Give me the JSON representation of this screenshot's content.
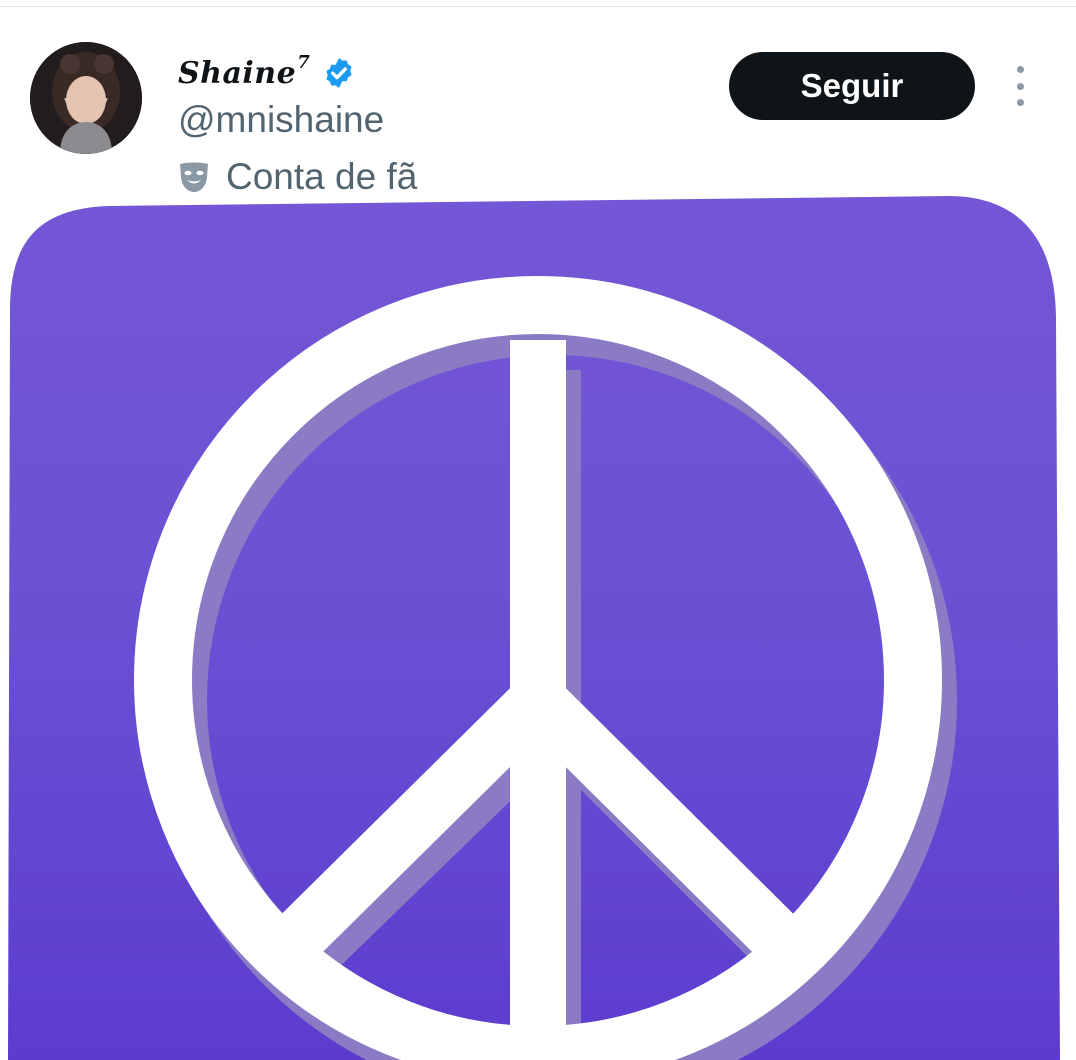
{
  "author": {
    "display_name": "Shaine",
    "display_name_superscript": "7",
    "handle": "@mnishaine",
    "account_label": "Conta de fã",
    "verified_color": "#1d9bf0"
  },
  "actions": {
    "follow_label": "Seguir"
  },
  "icons": {
    "verified": "verified-badge-icon",
    "account_label": "theater-mask-icon",
    "more": "more-options-icon"
  },
  "media": {
    "subject": "peace-sign-icon",
    "background_color": "#6a50d3",
    "symbol_color": "#ffffff"
  },
  "colors": {
    "text_primary": "#0f1419",
    "text_secondary": "#536471",
    "button_dark": "#0f1419"
  }
}
